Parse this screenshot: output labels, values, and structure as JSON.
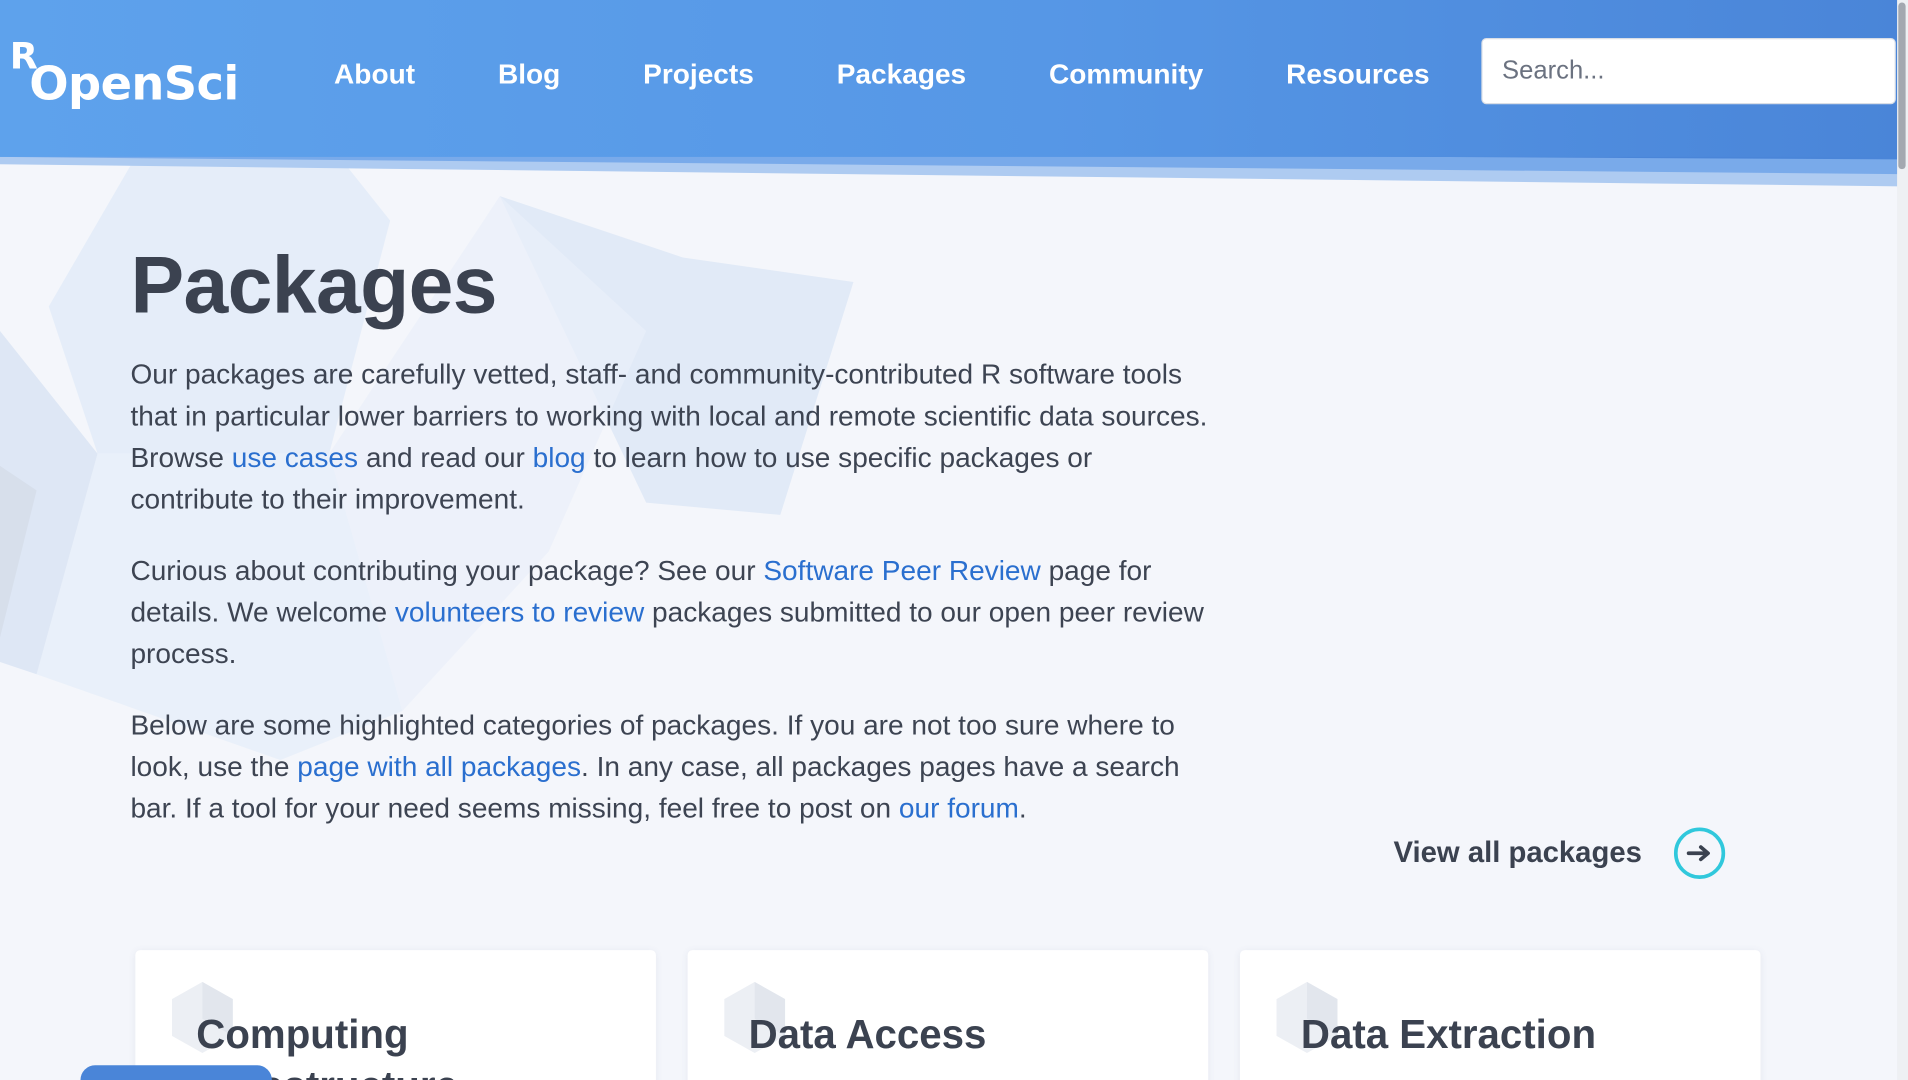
{
  "header": {
    "logo_r": "R",
    "logo_text": "OpenSci",
    "nav": [
      {
        "label": "About"
      },
      {
        "label": "Blog"
      },
      {
        "label": "Projects"
      },
      {
        "label": "Packages"
      },
      {
        "label": "Community"
      },
      {
        "label": "Resources"
      }
    ],
    "search": {
      "placeholder": "Search..."
    }
  },
  "main": {
    "title": "Packages",
    "p1": {
      "t1": "Our packages are carefully vetted, staff- and community-contributed R software tools that in particular lower barriers to working with local and remote scientific data sources. Browse ",
      "link_use_cases": "use cases",
      "t2": " and read our ",
      "link_blog": "blog",
      "t3": " to learn how to use specific packages or contribute to their improvement."
    },
    "p2": {
      "t1": "Curious about contributing your package? See our ",
      "link_peer_review": "Software Peer Review",
      "t2": " page for details. We welcome ",
      "link_volunteers": "volunteers to review",
      "t3": " packages submitted to our open peer review process."
    },
    "p3": {
      "t1": "Below are some highlighted categories of packages. If you are not too sure where to look, use the ",
      "link_all_packages": "page with all packages",
      "t2": ". In any case, all packages pages have a search bar. If a tool for your need seems missing, feel free to post on ",
      "link_forum": "our forum",
      "t3": "."
    }
  },
  "view_all": {
    "label": "View all packages",
    "icon": "arrow-right-circle-icon"
  },
  "cards": [
    {
      "title": "Computing Infrastructure",
      "icon": "hexagon-icon"
    },
    {
      "title": "Data Access",
      "icon": "hexagon-icon"
    },
    {
      "title": "Data Extraction",
      "icon": "hexagon-icon"
    }
  ],
  "colors": {
    "header_blue": "#5697e6",
    "link_blue": "#2a6fcf",
    "accent_cyan": "#30c8dc",
    "text_dark": "#3b4250"
  }
}
